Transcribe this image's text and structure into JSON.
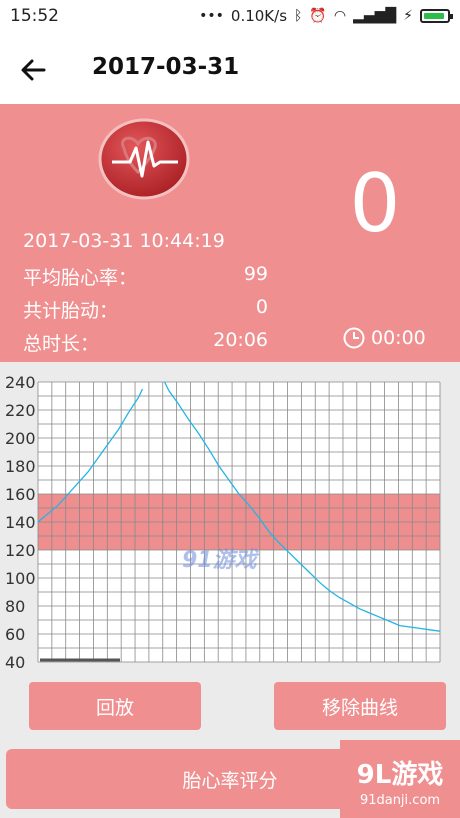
{
  "status_bar": {
    "time": "15:52",
    "speed": "0.10K/s",
    "icons": [
      "dots-icon",
      "bluetooth-icon",
      "alarm-icon",
      "wifi-icon",
      "signal-icon",
      "charging-icon",
      "battery-icon"
    ],
    "battery_level": 0.9
  },
  "app_bar": {
    "title": "2017-03-31"
  },
  "summary": {
    "datetime": "2017-03-31 10:44:19",
    "avg_label": "平均胎心率：",
    "avg_value": "99",
    "moves_label": "共计胎动：",
    "moves_value": "0",
    "duration_label": "总时长：",
    "duration_value": "20:06",
    "big_count": "0",
    "timer": "00:00"
  },
  "chart_data": {
    "type": "line",
    "ylim": [
      40,
      240
    ],
    "yticks": [
      "240",
      "220",
      "200",
      "180",
      "160",
      "140",
      "120",
      "100",
      "80",
      "60",
      "40"
    ],
    "normal_band": [
      120,
      160
    ],
    "series": [
      {
        "values": [
          [
            0,
            140
          ],
          [
            1,
            146
          ],
          [
            2,
            152
          ],
          [
            3,
            160
          ],
          [
            4,
            168
          ],
          [
            5,
            176
          ],
          [
            6,
            186
          ],
          [
            7,
            196
          ],
          [
            8,
            206
          ],
          [
            9,
            218
          ],
          [
            10,
            229
          ],
          [
            10.4,
            235
          ],
          [
            12.6,
            240
          ],
          [
            13,
            234
          ],
          [
            14,
            224
          ],
          [
            15,
            213
          ],
          [
            16,
            203
          ],
          [
            17,
            192
          ],
          [
            18,
            180
          ],
          [
            19,
            170
          ],
          [
            20,
            160
          ],
          [
            21,
            152
          ],
          [
            22,
            143
          ],
          [
            23,
            133
          ],
          [
            24,
            125
          ],
          [
            25,
            118
          ],
          [
            26,
            111
          ],
          [
            27,
            104
          ],
          [
            28,
            97
          ],
          [
            29,
            91
          ],
          [
            30,
            86
          ],
          [
            31,
            82
          ],
          [
            32,
            78
          ],
          [
            33,
            75
          ],
          [
            34,
            72
          ],
          [
            35,
            69
          ],
          [
            36,
            66
          ],
          [
            37,
            65
          ],
          [
            38,
            64
          ],
          [
            39,
            63
          ],
          [
            40,
            62
          ]
        ]
      }
    ]
  },
  "watermark": "91游戏",
  "buttons": {
    "replay": "回放",
    "remove_curve": "移除曲线",
    "score": "胎心率评分"
  },
  "corner_badge": {
    "line1": "9L游戏",
    "line2": "91danji.com"
  },
  "colors": {
    "accent": "#f08f90",
    "band": "#ef8e8f",
    "line": "#23b4e6"
  }
}
